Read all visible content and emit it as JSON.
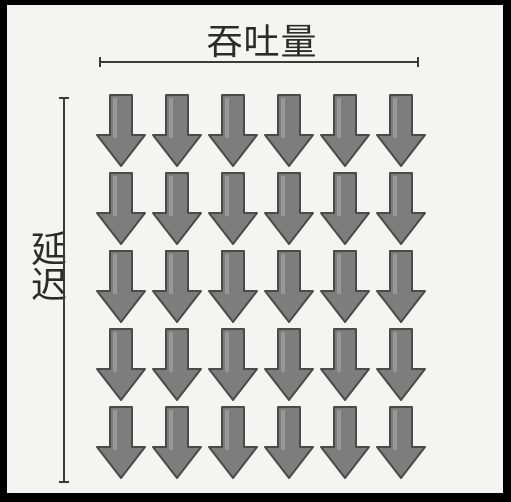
{
  "diagram": {
    "x_label": "吞吐量",
    "y_label": "延迟",
    "arrow_grid": {
      "rows": 5,
      "cols": 6,
      "arrow_direction": "down",
      "arrow_icon": "down-arrow-icon"
    }
  },
  "colors": {
    "arrow_fill": "#7d7d7d",
    "arrow_stroke": "#4a4a4a",
    "frame": "#000000",
    "background": "#f4f4f2",
    "text": "#2b2b2b"
  }
}
